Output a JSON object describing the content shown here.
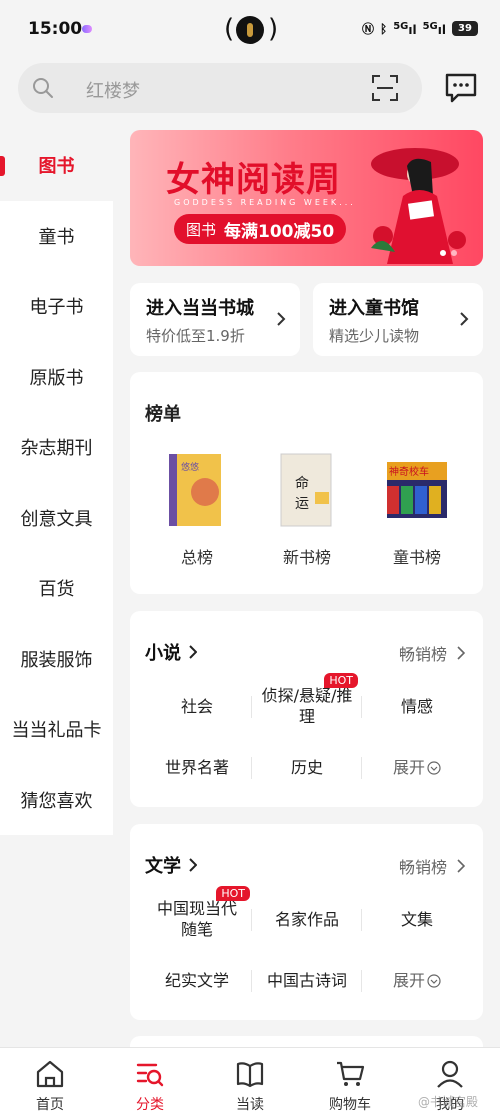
{
  "status_bar": {
    "time": "15:00",
    "network": "5G",
    "network2": "5G",
    "battery": "39"
  },
  "search": {
    "placeholder": "红楼梦"
  },
  "sidebar": {
    "items": [
      {
        "label": "图书",
        "active": true
      },
      {
        "label": "童书"
      },
      {
        "label": "电子书"
      },
      {
        "label": "原版书"
      },
      {
        "label": "杂志期刊"
      },
      {
        "label": "创意文具"
      },
      {
        "label": "百货"
      },
      {
        "label": "服装服饰"
      },
      {
        "label": "当当礼品卡"
      },
      {
        "label": "猜您喜欢"
      }
    ]
  },
  "banner": {
    "title": "女神阅读周",
    "subtitle": "GODDESS READING WEEK...",
    "promo_tag": "图书",
    "promo_text": "每满100减50"
  },
  "entries": [
    {
      "title": "进入当当书城",
      "subtitle": "特价低至1.9折"
    },
    {
      "title": "进入童书馆",
      "subtitle": "精选少儿读物"
    }
  ],
  "rankings": {
    "title": "榜单",
    "items": [
      {
        "label": "总榜",
        "cover_text": "悠悠岁月"
      },
      {
        "label": "新书榜",
        "cover_text": "命运"
      },
      {
        "label": "童书榜",
        "cover_text": "神奇校车"
      }
    ]
  },
  "fiction": {
    "title": "小说",
    "bestseller": "畅销榜",
    "rows": [
      [
        "社会",
        "侦探/悬疑/推理",
        "情感"
      ],
      [
        "世界名著",
        "历史",
        "展开"
      ]
    ],
    "hot_label": "HOT"
  },
  "literature": {
    "title": "文学",
    "bestseller": "畅销榜",
    "rows": [
      [
        "中国现当代随笔",
        "名家作品",
        "文集"
      ],
      [
        "纪实文学",
        "中国古诗词",
        "展开"
      ]
    ],
    "hot_label": "HOT"
  },
  "tabbar": {
    "items": [
      {
        "label": "首页",
        "icon": "home-icon"
      },
      {
        "label": "分类",
        "icon": "category-search-icon",
        "active": true
      },
      {
        "label": "当读",
        "icon": "book-icon"
      },
      {
        "label": "购物车",
        "icon": "cart-icon"
      },
      {
        "label": "我的",
        "icon": "person-icon"
      }
    ]
  },
  "watermark": "@书城宫殿",
  "colors": {
    "accent": "#e5162b",
    "background": "#f4f4f4"
  }
}
